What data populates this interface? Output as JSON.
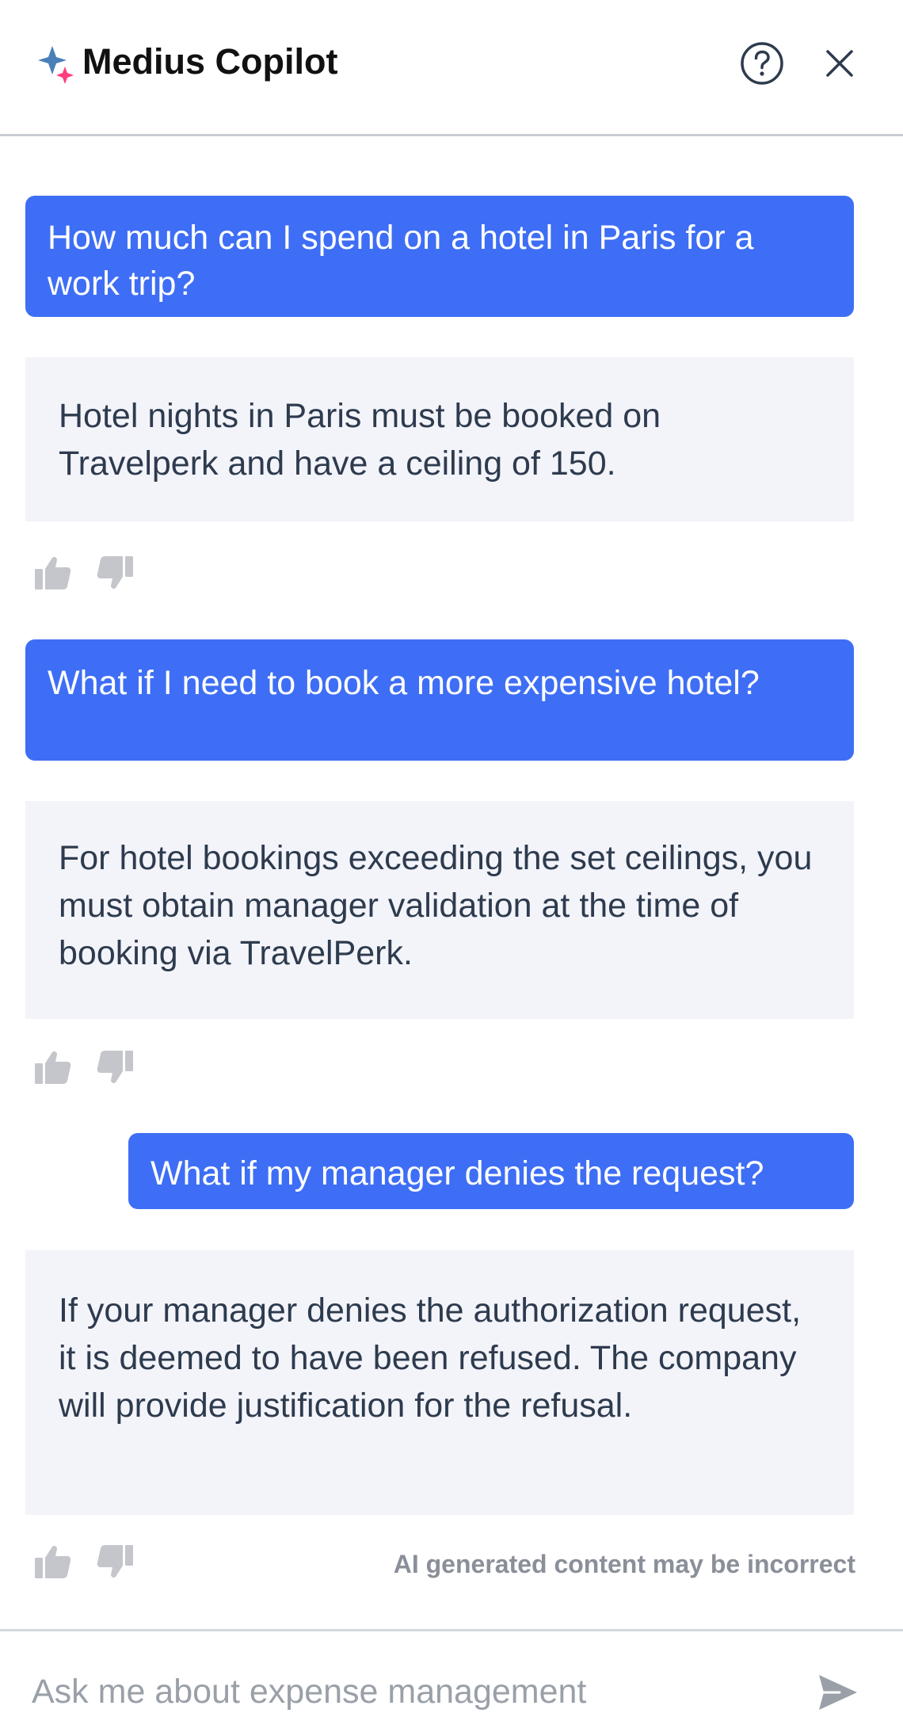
{
  "header": {
    "title": "Medius Copilot",
    "logo_icon": "sparkle-icon",
    "help_icon": "help-circle-icon",
    "close_icon": "close-icon"
  },
  "conversation": [
    {
      "role": "user",
      "text": "How much can I spend on a hotel in Paris for a work trip?"
    },
    {
      "role": "assistant",
      "text": "Hotel nights in Paris must be booked on Travelperk and have a ceiling of 150."
    },
    {
      "role": "user",
      "text": "What if I need to book a more expensive hotel?"
    },
    {
      "role": "assistant",
      "text": "For hotel bookings exceeding the set ceilings, you must obtain manager validation at the time of booking via TravelPerk."
    },
    {
      "role": "user",
      "text": "What if my manager denies the request?"
    },
    {
      "role": "assistant",
      "text": "If your manager denies the authorization request, it is deemed to have been refused. The company will provide justification for the refusal."
    }
  ],
  "feedback": {
    "thumbs_up_icon": "thumbs-up-icon",
    "thumbs_down_icon": "thumbs-down-icon"
  },
  "disclaimer": "AI generated content may be incorrect",
  "composer": {
    "placeholder": "Ask me about expense management",
    "value": "",
    "send_icon": "send-icon"
  },
  "colors": {
    "user_bubble": "#3e6ef5",
    "assistant_bubble": "#f3f4fa",
    "text_dark": "#2e3b4e",
    "muted": "#9aa0a8",
    "logo_blue": "#4a7fb8",
    "logo_pink": "#ff3d7f"
  }
}
